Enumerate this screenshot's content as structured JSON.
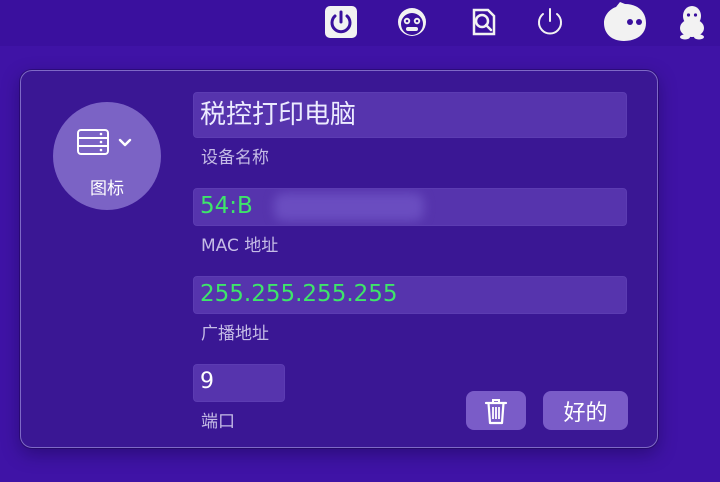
{
  "menubar": {
    "icons": [
      "power-app-icon",
      "monkey-face-icon",
      "search-document-icon",
      "power-icon",
      "chat-bubble-icon",
      "penguin-icon"
    ]
  },
  "device_icon": {
    "label": "图标",
    "icon": "server-rack-icon"
  },
  "fields": {
    "device_name": {
      "value": "税控打印电脑",
      "caption": "设备名称"
    },
    "mac_address": {
      "value": "54:B",
      "caption": "MAC 地址"
    },
    "broadcast_address": {
      "value": "255.255.255.255",
      "caption": "广播地址"
    },
    "port": {
      "value": "9",
      "caption": "端口"
    }
  },
  "buttons": {
    "delete_icon": "trash-icon",
    "ok_label": "好的"
  },
  "colors": {
    "background": "#3f13a6",
    "panel": "#3a1794",
    "field_text": "#3ee56a",
    "button": "#7a5cc8"
  }
}
